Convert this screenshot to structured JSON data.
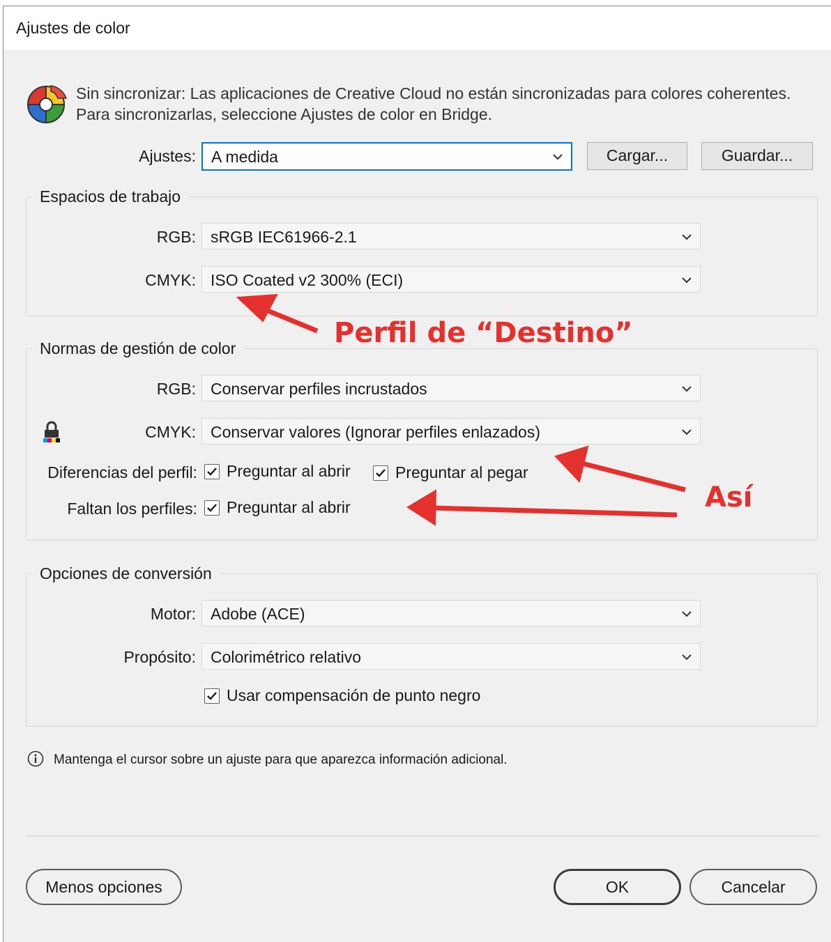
{
  "window": {
    "title": "Ajustes de color"
  },
  "sync": {
    "line1": "Sin sincronizar: Las aplicaciones de Creative Cloud no están sincronizadas para colores coherentes.",
    "line2": "Para sincronizarlas, seleccione Ajustes de color en Bridge."
  },
  "settings": {
    "label": "Ajustes:",
    "value": "A medida",
    "load_label": "Cargar...",
    "save_label": "Guardar..."
  },
  "working_spaces": {
    "legend": "Espacios de trabajo",
    "rgb_label": "RGB:",
    "rgb_value": "sRGB IEC61966-2.1",
    "cmyk_label": "CMYK:",
    "cmyk_value": "ISO Coated v2 300% (ECI)"
  },
  "policies": {
    "legend": "Normas de gestión de color",
    "rgb_label": "RGB:",
    "rgb_value": "Conservar perfiles incrustados",
    "cmyk_label": "CMYK:",
    "cmyk_value": "Conservar valores (Ignorar perfiles enlazados)",
    "mismatch_label": "Diferencias del perfil:",
    "mismatch_open": "Preguntar al abrir",
    "mismatch_paste": "Preguntar al pegar",
    "missing_label": "Faltan los perfiles:",
    "missing_open": "Preguntar al abrir",
    "checks": {
      "mismatch_open": true,
      "mismatch_paste": true,
      "missing_open": true
    }
  },
  "conversion": {
    "legend": "Opciones de conversión",
    "engine_label": "Motor:",
    "engine_value": "Adobe (ACE)",
    "intent_label": "Propósito:",
    "intent_value": "Colorimétrico relativo",
    "bpc_label": "Usar compensación de punto negro",
    "bpc_checked": true
  },
  "info_text": "Mantenga el cursor sobre un ajuste para que aparezca información adicional.",
  "buttons": {
    "fewer": "Menos opciones",
    "ok": "OK",
    "cancel": "Cancelar"
  },
  "annotations": {
    "destino": "Perfil de “Destino”",
    "asi": "Así"
  },
  "colors": {
    "annotation_red": "#e5312d",
    "focus_blue": "#0078d7"
  }
}
